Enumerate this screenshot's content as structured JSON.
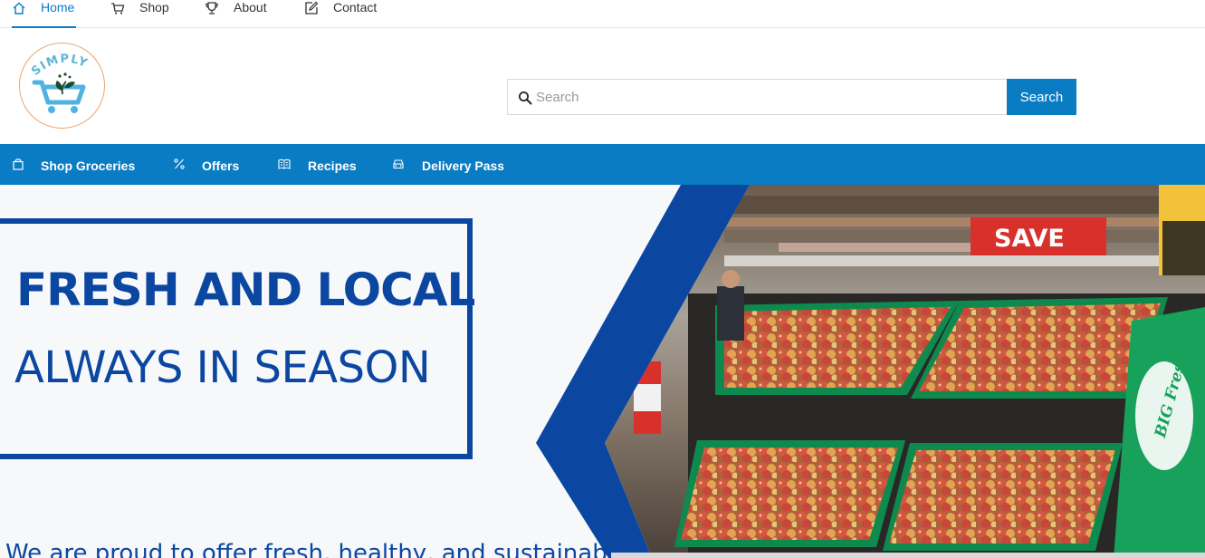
{
  "topnav": {
    "items": [
      {
        "label": "Home",
        "icon": "home-icon",
        "active": true
      },
      {
        "label": "Shop",
        "icon": "cart-icon"
      },
      {
        "label": "About",
        "icon": "trophy-icon"
      },
      {
        "label": "Contact",
        "icon": "edit-icon"
      }
    ]
  },
  "logo": {
    "text": "SIMPLY"
  },
  "search": {
    "placeholder": "Search",
    "value": "",
    "button_label": "Search"
  },
  "categories": {
    "items": [
      {
        "label": "Shop Groceries",
        "icon": "shopping-bag-icon"
      },
      {
        "label": "Offers",
        "icon": "percent-icon"
      },
      {
        "label": "Recipes",
        "icon": "book-icon"
      },
      {
        "label": "Delivery Pass",
        "icon": "car-icon"
      }
    ]
  },
  "hero": {
    "headline": "FRESH AND LOCAL",
    "subheadline": "ALWAYS IN SEASON",
    "tagline": "We are proud to offer fresh, healthy, and sustainable",
    "store_sign": "SAVE",
    "crate_brand": "BIG Fresh"
  },
  "colors": {
    "accent": "#0a7cc4",
    "hero_blue": "#0b47a1",
    "logo_ring": "#e9a56c",
    "crate_green": "#0e8a4e"
  }
}
